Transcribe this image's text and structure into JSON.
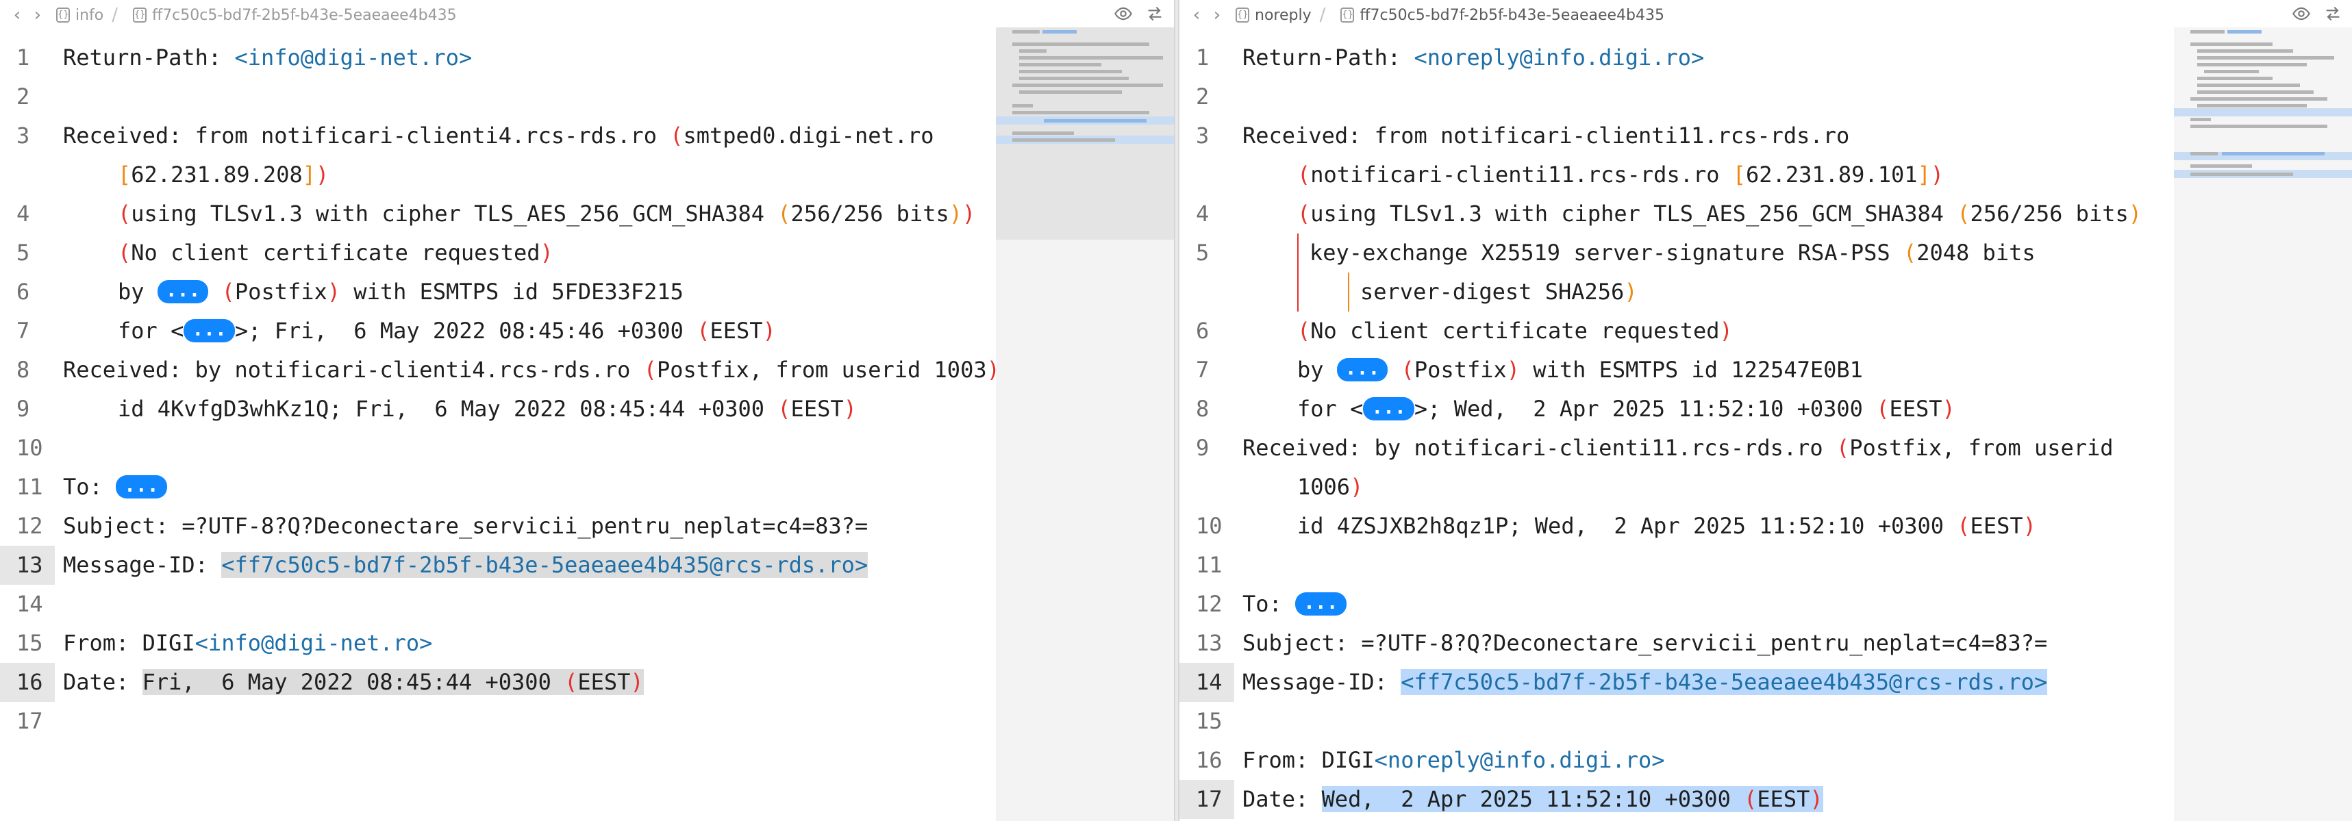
{
  "left": {
    "breadcrumb": [
      "info",
      "ff7c50c5-bd7f-2b5f-b43e-5eaeaee4b435"
    ],
    "file_icon": "{}",
    "lines": {
      "l1": {
        "n": "1",
        "a": "Return-Path: ",
        "link": "<info@digi-net.ro>"
      },
      "l2": {
        "n": "2"
      },
      "l3": {
        "n": "3",
        "a": "Received: from notificari-clienti4.rcs-rds.ro ",
        "paren": "(",
        "b": "smtped0.digi-net.ro"
      },
      "l3b": {
        "bo": "[",
        "b": "62.231.89.208",
        "bc": "]",
        "pc": ")"
      },
      "l4": {
        "n": "4",
        "po": "(",
        "a": "using TLSv1.3 with cipher TLS_AES_256_GCM_SHA384 ",
        "qo": "(",
        "b": "256/256 bits",
        "qc": ")",
        "pc": ")"
      },
      "l5": {
        "n": "5",
        "po": "(",
        "a": "No client certificate requested",
        "pc": ")"
      },
      "l6": {
        "n": "6",
        "a": "by ",
        "pill": "...",
        "po": "(",
        "b": "Postfix",
        "pc": ")",
        "c": " with ESMTPS id 5FDE33F215"
      },
      "l7": {
        "n": "7",
        "a": "for <",
        "pill": "...",
        "b": ">; Fri,  6 May 2022 08:45:46 +0300 ",
        "po": "(",
        "c": "EEST",
        "pc": ")"
      },
      "l8": {
        "n": "8",
        "a": "Received: by notificari-clienti4.rcs-rds.ro ",
        "po": "(",
        "b": "Postfix, from userid 1003",
        "pc": ")"
      },
      "l9": {
        "n": "9",
        "a": "id 4KvfgD3whKz1Q; Fri,  6 May 2022 08:45:44 +0300 ",
        "po": "(",
        "b": "EEST",
        "pc": ")"
      },
      "l10": {
        "n": "10"
      },
      "l11": {
        "n": "11",
        "a": "To: ",
        "pill": "..."
      },
      "l12": {
        "n": "12",
        "a": "Subject: =?UTF-8?Q?Deconectare_servicii_pentru_neplat=c4=83?="
      },
      "l13": {
        "n": "13",
        "a": "Message-ID: ",
        "link": "<ff7c50c5-bd7f-2b5f-b43e-5eaeaee4b435@rcs-rds.ro>"
      },
      "l14": {
        "n": "14"
      },
      "l15": {
        "n": "15",
        "a": "From: DIGI",
        "link": "<info@digi-net.ro>"
      },
      "l16": {
        "n": "16",
        "a": "Date: ",
        "b": "Fri,  6 May 2022 08:45:44 +0300 ",
        "po": "(",
        "c": "EEST",
        "pc": ")"
      },
      "l17": {
        "n": "17"
      }
    }
  },
  "right": {
    "breadcrumb": [
      "noreply",
      "ff7c50c5-bd7f-2b5f-b43e-5eaeaee4b435"
    ],
    "file_icon": "{}",
    "lines": {
      "l1": {
        "n": "1",
        "a": "Return-Path: ",
        "link": "<noreply@info.digi.ro>"
      },
      "l2": {
        "n": "2"
      },
      "l3": {
        "n": "3",
        "a": "Received: from notificari-clienti11.rcs-rds.ro"
      },
      "l3b": {
        "po": "(",
        "a": "notificari-clienti11.rcs-rds.ro ",
        "bo": "[",
        "b": "62.231.89.101",
        "bc": "]",
        "pc": ")"
      },
      "l4": {
        "n": "4",
        "po": "(",
        "a": "using TLSv1.3 with cipher TLS_AES_256_GCM_SHA384 ",
        "qo": "(",
        "b": "256/256 bits",
        "qc": ")"
      },
      "l5": {
        "n": "5",
        "a": "key-exchange X25519 server-signature RSA-PSS ",
        "qo": "(",
        "b": "2048 bits"
      },
      "l5b": {
        "a": "server-digest SHA256",
        "qc": ")"
      },
      "l6": {
        "n": "6",
        "po": "(",
        "a": "No client certificate requested",
        "pc": ")"
      },
      "l7": {
        "n": "7",
        "a": "by ",
        "pill": "...",
        "po": "(",
        "b": "Postfix",
        "pc": ")",
        "c": " with ESMTPS id 122547E0B1"
      },
      "l8": {
        "n": "8",
        "a": "for <",
        "pill": "...",
        "b": ">; Wed,  2 Apr 2025 11:52:10 +0300 ",
        "po": "(",
        "c": "EEST",
        "pc": ")"
      },
      "l9": {
        "n": "9",
        "a": "Received: by notificari-clienti11.rcs-rds.ro ",
        "po": "(",
        "b": "Postfix, from userid"
      },
      "l9b": {
        "a": "1006",
        "pc": ")"
      },
      "l10": {
        "n": "10",
        "a": "id 4ZSJXB2h8qz1P; Wed,  2 Apr 2025 11:52:10 +0300 ",
        "po": "(",
        "b": "EEST",
        "pc": ")"
      },
      "l11": {
        "n": "11"
      },
      "l12": {
        "n": "12",
        "a": "To: ",
        "pill": "..."
      },
      "l13": {
        "n": "13",
        "a": "Subject: =?UTF-8?Q?Deconectare_servicii_pentru_neplat=c4=83?="
      },
      "l14": {
        "n": "14",
        "a": "Message-ID: ",
        "link": "<ff7c50c5-bd7f-2b5f-b43e-5eaeaee4b435@rcs-rds.ro>"
      },
      "l15": {
        "n": "15"
      },
      "l16": {
        "n": "16",
        "a": "From: DIGI",
        "link": "<noreply@info.digi.ro>"
      },
      "l17": {
        "n": "17",
        "a": "Date: ",
        "b": "Wed,  2 Apr 2025 11:52:10 +0300 ",
        "po": "(",
        "c": "EEST",
        "pc": ")"
      }
    }
  },
  "icons": {
    "back": "chevron-left-icon",
    "forward": "chevron-right-icon",
    "preview": "eye-icon",
    "diff": "diff-swap-icon"
  },
  "colors": {
    "link": "#1e6fa8",
    "paren_outer": "#e5322b",
    "paren_inner": "#ee8a14",
    "pill": "#1187ff",
    "selection_blue": "#b9d8fb",
    "selection_gray": "#dcdcdc"
  }
}
